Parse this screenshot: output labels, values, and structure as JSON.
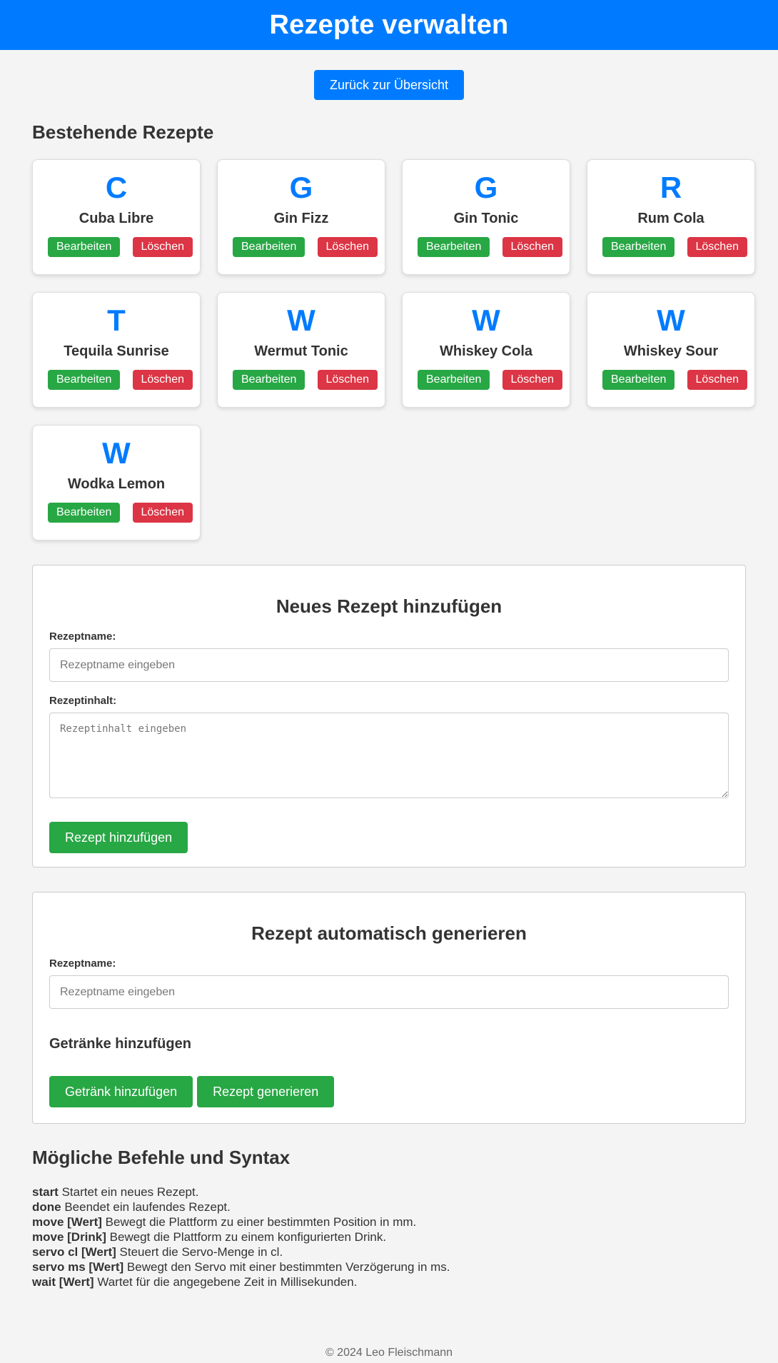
{
  "header": {
    "title": "Rezepte verwalten"
  },
  "nav": {
    "back_label": "Zurück zur Übersicht"
  },
  "recipes": {
    "title": "Bestehende Rezepte",
    "edit_label": "Bearbeiten",
    "delete_label": "Löschen",
    "items": [
      {
        "letter": "C",
        "name": "Cuba Libre"
      },
      {
        "letter": "G",
        "name": "Gin Fizz"
      },
      {
        "letter": "G",
        "name": "Gin Tonic"
      },
      {
        "letter": "R",
        "name": "Rum Cola"
      },
      {
        "letter": "T",
        "name": "Tequila Sunrise"
      },
      {
        "letter": "W",
        "name": "Wermut Tonic"
      },
      {
        "letter": "W",
        "name": "Whiskey Cola"
      },
      {
        "letter": "W",
        "name": "Whiskey Sour"
      },
      {
        "letter": "W",
        "name": "Wodka Lemon"
      }
    ]
  },
  "new_recipe": {
    "title": "Neues Rezept hinzufügen",
    "name_label": "Rezeptname:",
    "name_placeholder": "Rezeptname eingeben",
    "content_label": "Rezeptinhalt:",
    "content_placeholder": "Rezeptinhalt eingeben",
    "submit_label": "Rezept hinzufügen"
  },
  "auto_recipe": {
    "title": "Rezept automatisch generieren",
    "name_label": "Rezeptname:",
    "name_placeholder": "Rezeptname eingeben",
    "drinks_title": "Getränke hinzufügen",
    "add_drink_label": "Getränk hinzufügen",
    "generate_label": "Rezept generieren"
  },
  "syntax": {
    "title": "Mögliche Befehle und Syntax",
    "commands": [
      {
        "cmd": "start",
        "desc": "Startet ein neues Rezept."
      },
      {
        "cmd": "done",
        "desc": "Beendet ein laufendes Rezept."
      },
      {
        "cmd": "move [Wert]",
        "desc": "Bewegt die Plattform zu einer bestimmten Position in mm."
      },
      {
        "cmd": "move [Drink]",
        "desc": "Bewegt die Plattform zu einem konfigurierten Drink."
      },
      {
        "cmd": "servo cl [Wert]",
        "desc": "Steuert die Servo-Menge in cl."
      },
      {
        "cmd": "servo ms [Wert]",
        "desc": "Bewegt den Servo mit einer bestimmten Verzögerung in ms."
      },
      {
        "cmd": "wait [Wert]",
        "desc": "Wartet für die angegebene Zeit in Millisekunden."
      }
    ]
  },
  "footer": {
    "text": "© 2024 Leo Fleischmann"
  },
  "colors": {
    "primary": "#007bff",
    "success": "#28a745",
    "danger": "#dc3545",
    "background": "#f4f4f4"
  }
}
